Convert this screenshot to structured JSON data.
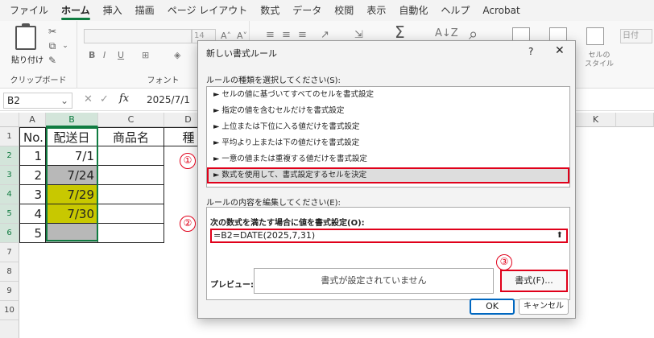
{
  "menu": [
    "ファイル",
    "ホーム",
    "挿入",
    "描画",
    "ページ レイアウト",
    "数式",
    "データ",
    "校閲",
    "表示",
    "自動化",
    "ヘルプ",
    "Acrobat"
  ],
  "ribbon": {
    "paste_label": "貼り付け",
    "clipboard_label": "クリップボード",
    "font_label": "フォント",
    "font_size": "14",
    "cell_style_label": "セルの\nスタイル",
    "number_format": "日付"
  },
  "formula_bar": {
    "name_box": "B2",
    "fx": "fx",
    "value": "2025/7/1"
  },
  "columns": [
    "A",
    "B",
    "C",
    "D",
    "E",
    "F",
    "G",
    "H",
    "I",
    "J",
    "K"
  ],
  "rows": [
    "1",
    "2",
    "3",
    "4",
    "5",
    "6",
    "7",
    "8",
    "9",
    "10"
  ],
  "table": {
    "headers": [
      "No.",
      "配送日",
      "商品名",
      "種"
    ],
    "rows": [
      [
        "1",
        "7/1",
        ""
      ],
      [
        "2",
        "7/24",
        ""
      ],
      [
        "3",
        "7/29",
        ""
      ],
      [
        "4",
        "7/30",
        ""
      ],
      [
        "5",
        "",
        ""
      ]
    ]
  },
  "dialog": {
    "title": "新しい書式ルール",
    "help": "?",
    "close": "✕",
    "rule_type_label": "ルールの種類を選択してください(S):",
    "rules": [
      "► セルの値に基づいてすべてのセルを書式設定",
      "► 指定の値を含むセルだけを書式設定",
      "► 上位または下位に入る値だけを書式設定",
      "► 平均より上または下の値だけを書式設定",
      "► 一意の値または重複する値だけを書式設定",
      "► 数式を使用して、書式設定するセルを決定"
    ],
    "edit_label": "ルールの内容を編集してください(E):",
    "formula_label": "次の数式を満たす場合に値を書式設定(O):",
    "formula": "=B2=DATE(2025,7,31)",
    "preview_label": "プレビュー:",
    "preview_text": "書式が設定されていません",
    "format_button": "書式(F)...",
    "ok": "OK",
    "cancel": "キャンセル"
  },
  "badges": [
    "①",
    "②",
    "③"
  ],
  "colors": {
    "accent": "#107c41",
    "highlight_red": "#e0001a",
    "yellow_fill": "#c8c800",
    "gray_fill": "#b8b8b8"
  }
}
